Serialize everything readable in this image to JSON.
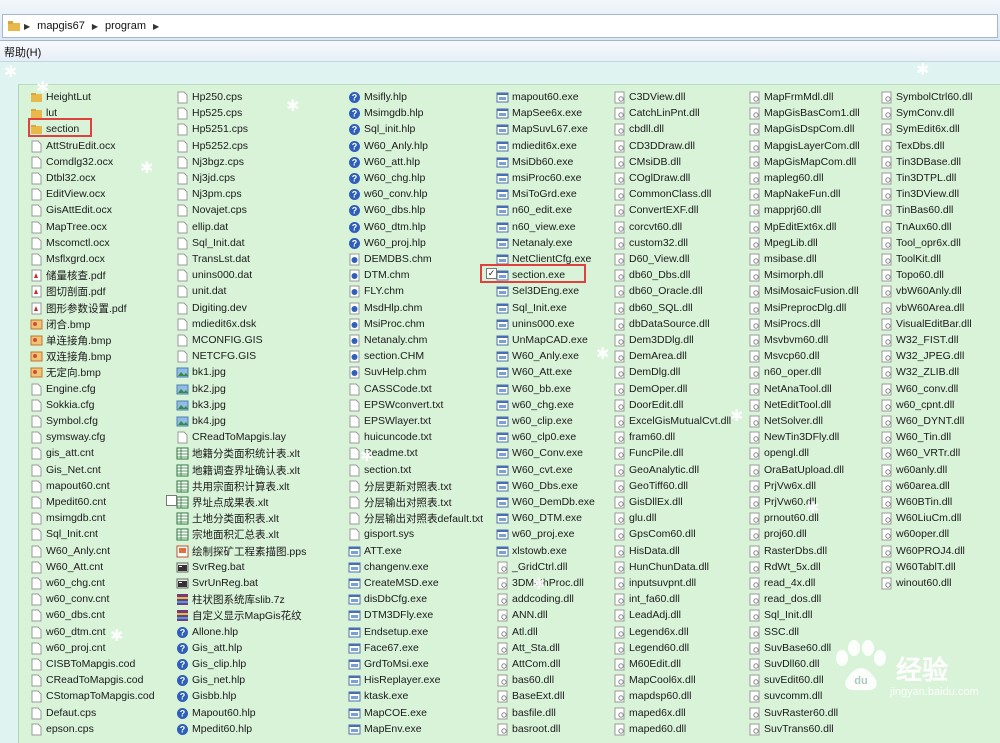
{
  "address_bar": {
    "segments": [
      "mapgis67",
      "program"
    ]
  },
  "menubar": {
    "help_label": "帮助(H)"
  },
  "columns": [
    [
      {
        "name": "HeightLut",
        "icon": "folder"
      },
      {
        "name": "lut",
        "icon": "folder"
      },
      {
        "name": "section",
        "icon": "folder"
      },
      {
        "name": "AttStruEdit.ocx",
        "icon": "file"
      },
      {
        "name": "Comdlg32.ocx",
        "icon": "file"
      },
      {
        "name": "Dtbl32.ocx",
        "icon": "file"
      },
      {
        "name": "EditView.ocx",
        "icon": "file"
      },
      {
        "name": "GisAttEdit.ocx",
        "icon": "file"
      },
      {
        "name": "MapTree.ocx",
        "icon": "file"
      },
      {
        "name": "Mscomctl.ocx",
        "icon": "file"
      },
      {
        "name": "Msflxgrd.ocx",
        "icon": "file"
      },
      {
        "name": "储量核查.pdf",
        "icon": "pdf"
      },
      {
        "name": "图切剖面.pdf",
        "icon": "pdf"
      },
      {
        "name": "图形参数设置.pdf",
        "icon": "pdf"
      },
      {
        "name": "闭合.bmp",
        "icon": "bmp"
      },
      {
        "name": "单连接角.bmp",
        "icon": "bmp"
      },
      {
        "name": "双连接角.bmp",
        "icon": "bmp"
      },
      {
        "name": "无定向.bmp",
        "icon": "bmp"
      },
      {
        "name": "Engine.cfg",
        "icon": "file"
      },
      {
        "name": "Sokkia.cfg",
        "icon": "file"
      },
      {
        "name": "Symbol.cfg",
        "icon": "file"
      },
      {
        "name": "symsway.cfg",
        "icon": "file"
      },
      {
        "name": "gis_att.cnt",
        "icon": "file"
      },
      {
        "name": "Gis_Net.cnt",
        "icon": "file"
      },
      {
        "name": "mapout60.cnt",
        "icon": "file"
      },
      {
        "name": "Mpedit60.cnt",
        "icon": "file"
      },
      {
        "name": "msimgdb.cnt",
        "icon": "file"
      },
      {
        "name": "Sql_Init.cnt",
        "icon": "file"
      },
      {
        "name": "W60_Anly.cnt",
        "icon": "file"
      },
      {
        "name": "W60_Att.cnt",
        "icon": "file"
      },
      {
        "name": "w60_chg.cnt",
        "icon": "file"
      },
      {
        "name": "w60_conv.cnt",
        "icon": "file"
      },
      {
        "name": "w60_dbs.cnt",
        "icon": "file"
      },
      {
        "name": "w60_dtm.cnt",
        "icon": "file"
      },
      {
        "name": "w60_proj.cnt",
        "icon": "file"
      },
      {
        "name": "CISBToMapgis.cod",
        "icon": "file"
      },
      {
        "name": "CReadToMapgis.cod",
        "icon": "file"
      },
      {
        "name": "CStomapToMapgis.cod",
        "icon": "file"
      },
      {
        "name": "Defaut.cps",
        "icon": "file"
      },
      {
        "name": "epson.cps",
        "icon": "file"
      }
    ],
    [
      {
        "name": "Hp250.cps",
        "icon": "file"
      },
      {
        "name": "Hp525.cps",
        "icon": "file"
      },
      {
        "name": "Hp5251.cps",
        "icon": "file"
      },
      {
        "name": "Hp5252.cps",
        "icon": "file"
      },
      {
        "name": "Nj3bgz.cps",
        "icon": "file"
      },
      {
        "name": "Nj3jd.cps",
        "icon": "file"
      },
      {
        "name": "Nj3pm.cps",
        "icon": "file"
      },
      {
        "name": "Novajet.cps",
        "icon": "file"
      },
      {
        "name": "ellip.dat",
        "icon": "file"
      },
      {
        "name": "Sql_Init.dat",
        "icon": "file"
      },
      {
        "name": "TransLst.dat",
        "icon": "file"
      },
      {
        "name": "unins000.dat",
        "icon": "file"
      },
      {
        "name": "unit.dat",
        "icon": "file"
      },
      {
        "name": "Digiting.dev",
        "icon": "file"
      },
      {
        "name": "mdiedit6x.dsk",
        "icon": "file"
      },
      {
        "name": "MCONFIG.GIS",
        "icon": "file"
      },
      {
        "name": "NETCFG.GIS",
        "icon": "file"
      },
      {
        "name": "bk1.jpg",
        "icon": "jpg"
      },
      {
        "name": "bk2.jpg",
        "icon": "jpg"
      },
      {
        "name": "bk3.jpg",
        "icon": "jpg"
      },
      {
        "name": "bk4.jpg",
        "icon": "jpg"
      },
      {
        "name": "CReadToMapgis.lay",
        "icon": "file"
      },
      {
        "name": "地籍分类面积统计表.xlt",
        "icon": "xlt"
      },
      {
        "name": "地籍调查界址确认表.xlt",
        "icon": "xlt"
      },
      {
        "name": "共用宗面积计算表.xlt",
        "icon": "xlt"
      },
      {
        "name": "界址点成果表.xlt",
        "icon": "xlt"
      },
      {
        "name": "土地分类面积表.xlt",
        "icon": "xlt"
      },
      {
        "name": "宗地面积汇总表.xlt",
        "icon": "xlt"
      },
      {
        "name": "绘制探矿工程素描图.pps",
        "icon": "pps"
      },
      {
        "name": "SvrReg.bat",
        "icon": "bat"
      },
      {
        "name": "SvrUnReg.bat",
        "icon": "bat"
      },
      {
        "name": "柱状图系统库slib.7z",
        "icon": "zip"
      },
      {
        "name": "自定义显示MapGis花纹",
        "icon": "zip"
      },
      {
        "name": "Allone.hlp",
        "icon": "hlp"
      },
      {
        "name": "Gis_att.hlp",
        "icon": "hlp"
      },
      {
        "name": "Gis_clip.hlp",
        "icon": "hlp"
      },
      {
        "name": "Gis_net.hlp",
        "icon": "hlp"
      },
      {
        "name": "Gisbb.hlp",
        "icon": "hlp"
      },
      {
        "name": "Mapout60.hlp",
        "icon": "hlp"
      },
      {
        "name": "Mpedit60.hlp",
        "icon": "hlp"
      }
    ],
    [
      {
        "name": "Msifly.hlp",
        "icon": "hlp"
      },
      {
        "name": "Msimgdb.hlp",
        "icon": "hlp"
      },
      {
        "name": "Sql_init.hlp",
        "icon": "hlp"
      },
      {
        "name": "W60_Anly.hlp",
        "icon": "hlp"
      },
      {
        "name": "W60_att.hlp",
        "icon": "hlp"
      },
      {
        "name": "W60_chg.hlp",
        "icon": "hlp"
      },
      {
        "name": "w60_conv.hlp",
        "icon": "hlp"
      },
      {
        "name": "W60_dbs.hlp",
        "icon": "hlp"
      },
      {
        "name": "W60_dtm.hlp",
        "icon": "hlp"
      },
      {
        "name": "W60_proj.hlp",
        "icon": "hlp"
      },
      {
        "name": "DEMDBS.chm",
        "icon": "chm"
      },
      {
        "name": "DTM.chm",
        "icon": "chm"
      },
      {
        "name": "FLY.chm",
        "icon": "chm"
      },
      {
        "name": "MsdHlp.chm",
        "icon": "chm"
      },
      {
        "name": "MsiProc.chm",
        "icon": "chm"
      },
      {
        "name": "Netanaly.chm",
        "icon": "chm"
      },
      {
        "name": "section.CHM",
        "icon": "chm"
      },
      {
        "name": "SuvHelp.chm",
        "icon": "chm"
      },
      {
        "name": "CASSCode.txt",
        "icon": "file"
      },
      {
        "name": "EPSWconvert.txt",
        "icon": "file"
      },
      {
        "name": "EPSWlayer.txt",
        "icon": "file"
      },
      {
        "name": "huicuncode.txt",
        "icon": "file"
      },
      {
        "name": "Readme.txt",
        "icon": "file"
      },
      {
        "name": "section.txt",
        "icon": "file"
      },
      {
        "name": "分层更新对照表.txt",
        "icon": "file"
      },
      {
        "name": "分层输出对照表.txt",
        "icon": "file"
      },
      {
        "name": "分层输出对照表default.txt",
        "icon": "file"
      },
      {
        "name": "gisport.sys",
        "icon": "file"
      },
      {
        "name": "ATT.exe",
        "icon": "exe"
      },
      {
        "name": "changenv.exe",
        "icon": "exe"
      },
      {
        "name": "CreateMSD.exe",
        "icon": "exe"
      },
      {
        "name": "disDbCfg.exe",
        "icon": "exe"
      },
      {
        "name": "DTM3DFly.exe",
        "icon": "exe"
      },
      {
        "name": "Endsetup.exe",
        "icon": "exe"
      },
      {
        "name": "Face67.exe",
        "icon": "exe"
      },
      {
        "name": "GrdToMsi.exe",
        "icon": "exe"
      },
      {
        "name": "HisReplayer.exe",
        "icon": "exe"
      },
      {
        "name": "ktask.exe",
        "icon": "exe"
      },
      {
        "name": "MapCOE.exe",
        "icon": "exe"
      },
      {
        "name": "MapEnv.exe",
        "icon": "exe"
      }
    ],
    [
      {
        "name": "mapout60.exe",
        "icon": "exe"
      },
      {
        "name": "MapSee6x.exe",
        "icon": "exe"
      },
      {
        "name": "MapSuvL67.exe",
        "icon": "exe"
      },
      {
        "name": "mdiedit6x.exe",
        "icon": "exe"
      },
      {
        "name": "MsiDb60.exe",
        "icon": "exe"
      },
      {
        "name": "msiProc60.exe",
        "icon": "exe"
      },
      {
        "name": "MsiToGrd.exe",
        "icon": "exe"
      },
      {
        "name": "n60_edit.exe",
        "icon": "exe"
      },
      {
        "name": "n60_view.exe",
        "icon": "exe"
      },
      {
        "name": "Netanaly.exe",
        "icon": "exe"
      },
      {
        "name": "NetClientCfg.exe",
        "icon": "exe"
      },
      {
        "name": "section.exe",
        "icon": "exe"
      },
      {
        "name": "Sel3DEng.exe",
        "icon": "exe"
      },
      {
        "name": "Sql_Init.exe",
        "icon": "exe"
      },
      {
        "name": "unins000.exe",
        "icon": "exe"
      },
      {
        "name": "UnMapCAD.exe",
        "icon": "exe"
      },
      {
        "name": "W60_Anly.exe",
        "icon": "exe"
      },
      {
        "name": "W60_Att.exe",
        "icon": "exe"
      },
      {
        "name": "W60_bb.exe",
        "icon": "exe"
      },
      {
        "name": "w60_chg.exe",
        "icon": "exe"
      },
      {
        "name": "w60_clip.exe",
        "icon": "exe"
      },
      {
        "name": "w60_clp0.exe",
        "icon": "exe"
      },
      {
        "name": "W60_Conv.exe",
        "icon": "exe"
      },
      {
        "name": "W60_cvt.exe",
        "icon": "exe"
      },
      {
        "name": "W60_Dbs.exe",
        "icon": "exe"
      },
      {
        "name": "W60_DemDb.exe",
        "icon": "exe"
      },
      {
        "name": "W60_DTM.exe",
        "icon": "exe"
      },
      {
        "name": "w60_proj.exe",
        "icon": "exe"
      },
      {
        "name": "xlstowb.exe",
        "icon": "exe"
      },
      {
        "name": "_GridCtrl.dll",
        "icon": "dll"
      },
      {
        "name": "3DMathProc.dll",
        "icon": "dll"
      },
      {
        "name": "addcoding.dll",
        "icon": "dll"
      },
      {
        "name": "ANN.dll",
        "icon": "dll"
      },
      {
        "name": "Atl.dll",
        "icon": "dll"
      },
      {
        "name": "Att_Sta.dll",
        "icon": "dll"
      },
      {
        "name": "AttCom.dll",
        "icon": "dll"
      },
      {
        "name": "bas60.dll",
        "icon": "dll"
      },
      {
        "name": "BaseExt.dll",
        "icon": "dll"
      },
      {
        "name": "basfile.dll",
        "icon": "dll"
      },
      {
        "name": "basroot.dll",
        "icon": "dll"
      }
    ],
    [
      {
        "name": "C3DView.dll",
        "icon": "dll"
      },
      {
        "name": "CatchLinPnt.dll",
        "icon": "dll"
      },
      {
        "name": "cbdll.dll",
        "icon": "dll"
      },
      {
        "name": "CD3DDraw.dll",
        "icon": "dll"
      },
      {
        "name": "CMsiDB.dll",
        "icon": "dll"
      },
      {
        "name": "COglDraw.dll",
        "icon": "dll"
      },
      {
        "name": "CommonClass.dll",
        "icon": "dll"
      },
      {
        "name": "ConvertEXF.dll",
        "icon": "dll"
      },
      {
        "name": "corcvt60.dll",
        "icon": "dll"
      },
      {
        "name": "custom32.dll",
        "icon": "dll"
      },
      {
        "name": "D60_View.dll",
        "icon": "dll"
      },
      {
        "name": "db60_Dbs.dll",
        "icon": "dll"
      },
      {
        "name": "db60_Oracle.dll",
        "icon": "dll"
      },
      {
        "name": "db60_SQL.dll",
        "icon": "dll"
      },
      {
        "name": "dbDataSource.dll",
        "icon": "dll"
      },
      {
        "name": "Dem3DDlg.dll",
        "icon": "dll"
      },
      {
        "name": "DemArea.dll",
        "icon": "dll"
      },
      {
        "name": "DemDlg.dll",
        "icon": "dll"
      },
      {
        "name": "DemOper.dll",
        "icon": "dll"
      },
      {
        "name": "DoorEdit.dll",
        "icon": "dll"
      },
      {
        "name": "ExcelGisMutualCvt.dll",
        "icon": "dll"
      },
      {
        "name": "fram60.dll",
        "icon": "dll"
      },
      {
        "name": "FuncPile.dll",
        "icon": "dll"
      },
      {
        "name": "GeoAnalytic.dll",
        "icon": "dll"
      },
      {
        "name": "GeoTiff60.dll",
        "icon": "dll"
      },
      {
        "name": "GisDllEx.dll",
        "icon": "dll"
      },
      {
        "name": "glu.dll",
        "icon": "dll"
      },
      {
        "name": "GpsCom60.dll",
        "icon": "dll"
      },
      {
        "name": "HisData.dll",
        "icon": "dll"
      },
      {
        "name": "HunChunData.dll",
        "icon": "dll"
      },
      {
        "name": "inputsuvpnt.dll",
        "icon": "dll"
      },
      {
        "name": "int_fa60.dll",
        "icon": "dll"
      },
      {
        "name": "LeadAdj.dll",
        "icon": "dll"
      },
      {
        "name": "Legend6x.dll",
        "icon": "dll"
      },
      {
        "name": "Legend60.dll",
        "icon": "dll"
      },
      {
        "name": "M60Edit.dll",
        "icon": "dll"
      },
      {
        "name": "MapCool6x.dll",
        "icon": "dll"
      },
      {
        "name": "mapdsp60.dll",
        "icon": "dll"
      },
      {
        "name": "maped6x.dll",
        "icon": "dll"
      },
      {
        "name": "maped60.dll",
        "icon": "dll"
      }
    ],
    [
      {
        "name": "MapFrmMdl.dll",
        "icon": "dll"
      },
      {
        "name": "MapGisBasCom1.dll",
        "icon": "dll"
      },
      {
        "name": "MapGisDspCom.dll",
        "icon": "dll"
      },
      {
        "name": "MapgisLayerCom.dll",
        "icon": "dll"
      },
      {
        "name": "MapGisMapCom.dll",
        "icon": "dll"
      },
      {
        "name": "mapleg60.dll",
        "icon": "dll"
      },
      {
        "name": "MapNakeFun.dll",
        "icon": "dll"
      },
      {
        "name": "mapprj60.dll",
        "icon": "dll"
      },
      {
        "name": "MpEditExt6x.dll",
        "icon": "dll"
      },
      {
        "name": "MpegLib.dll",
        "icon": "dll"
      },
      {
        "name": "msibase.dll",
        "icon": "dll"
      },
      {
        "name": "Msimorph.dll",
        "icon": "dll"
      },
      {
        "name": "MsiMosaicFusion.dll",
        "icon": "dll"
      },
      {
        "name": "MsiPreprocDlg.dll",
        "icon": "dll"
      },
      {
        "name": "MsiProcs.dll",
        "icon": "dll"
      },
      {
        "name": "Msvbvm60.dll",
        "icon": "dll"
      },
      {
        "name": "Msvcp60.dll",
        "icon": "dll"
      },
      {
        "name": "n60_oper.dll",
        "icon": "dll"
      },
      {
        "name": "NetAnaTool.dll",
        "icon": "dll"
      },
      {
        "name": "NetEditTool.dll",
        "icon": "dll"
      },
      {
        "name": "NetSolver.dll",
        "icon": "dll"
      },
      {
        "name": "NewTin3DFly.dll",
        "icon": "dll"
      },
      {
        "name": "opengl.dll",
        "icon": "dll"
      },
      {
        "name": "OraBatUpload.dll",
        "icon": "dll"
      },
      {
        "name": "PrjVw6x.dll",
        "icon": "dll"
      },
      {
        "name": "PrjVw60.dll",
        "icon": "dll"
      },
      {
        "name": "prnout60.dll",
        "icon": "dll"
      },
      {
        "name": "proj60.dll",
        "icon": "dll"
      },
      {
        "name": "RasterDbs.dll",
        "icon": "dll"
      },
      {
        "name": "RdWt_5x.dll",
        "icon": "dll"
      },
      {
        "name": "read_4x.dll",
        "icon": "dll"
      },
      {
        "name": "read_dos.dll",
        "icon": "dll"
      },
      {
        "name": "Sql_Init.dll",
        "icon": "dll"
      },
      {
        "name": "SSC.dll",
        "icon": "dll"
      },
      {
        "name": "SuvBase60.dll",
        "icon": "dll"
      },
      {
        "name": "SuvDll60.dll",
        "icon": "dll"
      },
      {
        "name": "suvEdit60.dll",
        "icon": "dll"
      },
      {
        "name": "suvcomm.dll",
        "icon": "dll"
      },
      {
        "name": "SuvRaster60.dll",
        "icon": "dll"
      },
      {
        "name": "SuvTrans60.dll",
        "icon": "dll"
      }
    ],
    [
      {
        "name": "SymbolCtrl60.dll",
        "icon": "dll"
      },
      {
        "name": "SymConv.dll",
        "icon": "dll"
      },
      {
        "name": "SymEdit6x.dll",
        "icon": "dll"
      },
      {
        "name": "TexDbs.dll",
        "icon": "dll"
      },
      {
        "name": "Tin3DBase.dll",
        "icon": "dll"
      },
      {
        "name": "Tin3DTPL.dll",
        "icon": "dll"
      },
      {
        "name": "Tin3DView.dll",
        "icon": "dll"
      },
      {
        "name": "TinBas60.dll",
        "icon": "dll"
      },
      {
        "name": "TnAux60.dll",
        "icon": "dll"
      },
      {
        "name": "Tool_opr6x.dll",
        "icon": "dll"
      },
      {
        "name": "ToolKit.dll",
        "icon": "dll"
      },
      {
        "name": "Topo60.dll",
        "icon": "dll"
      },
      {
        "name": "vbW60Anly.dll",
        "icon": "dll"
      },
      {
        "name": "vbW60Area.dll",
        "icon": "dll"
      },
      {
        "name": "VisualEditBar.dll",
        "icon": "dll"
      },
      {
        "name": "W32_FIST.dll",
        "icon": "dll"
      },
      {
        "name": "W32_JPEG.dll",
        "icon": "dll"
      },
      {
        "name": "W32_ZLIB.dll",
        "icon": "dll"
      },
      {
        "name": "W60_conv.dll",
        "icon": "dll"
      },
      {
        "name": "w60_cpnt.dll",
        "icon": "dll"
      },
      {
        "name": "W60_DYNT.dll",
        "icon": "dll"
      },
      {
        "name": "W60_Tin.dll",
        "icon": "dll"
      },
      {
        "name": "W60_VRTr.dll",
        "icon": "dll"
      },
      {
        "name": "w60anly.dll",
        "icon": "dll"
      },
      {
        "name": "w60area.dll",
        "icon": "dll"
      },
      {
        "name": "W60BTin.dll",
        "icon": "dll"
      },
      {
        "name": "W60LiuCm.dll",
        "icon": "dll"
      },
      {
        "name": "w60oper.dll",
        "icon": "dll"
      },
      {
        "name": "W60PROJ4.dll",
        "icon": "dll"
      },
      {
        "name": "W60TablT.dll",
        "icon": "dll"
      },
      {
        "name": "winout60.dll",
        "icon": "dll"
      }
    ]
  ],
  "watermark": {
    "brand": "经验",
    "sub": "jingyan.baidu.com"
  },
  "colors": {
    "folder": "#e8b84a",
    "help": "#2f5fb8",
    "pdf": "#c92a2a",
    "highlight": "#e04040"
  }
}
